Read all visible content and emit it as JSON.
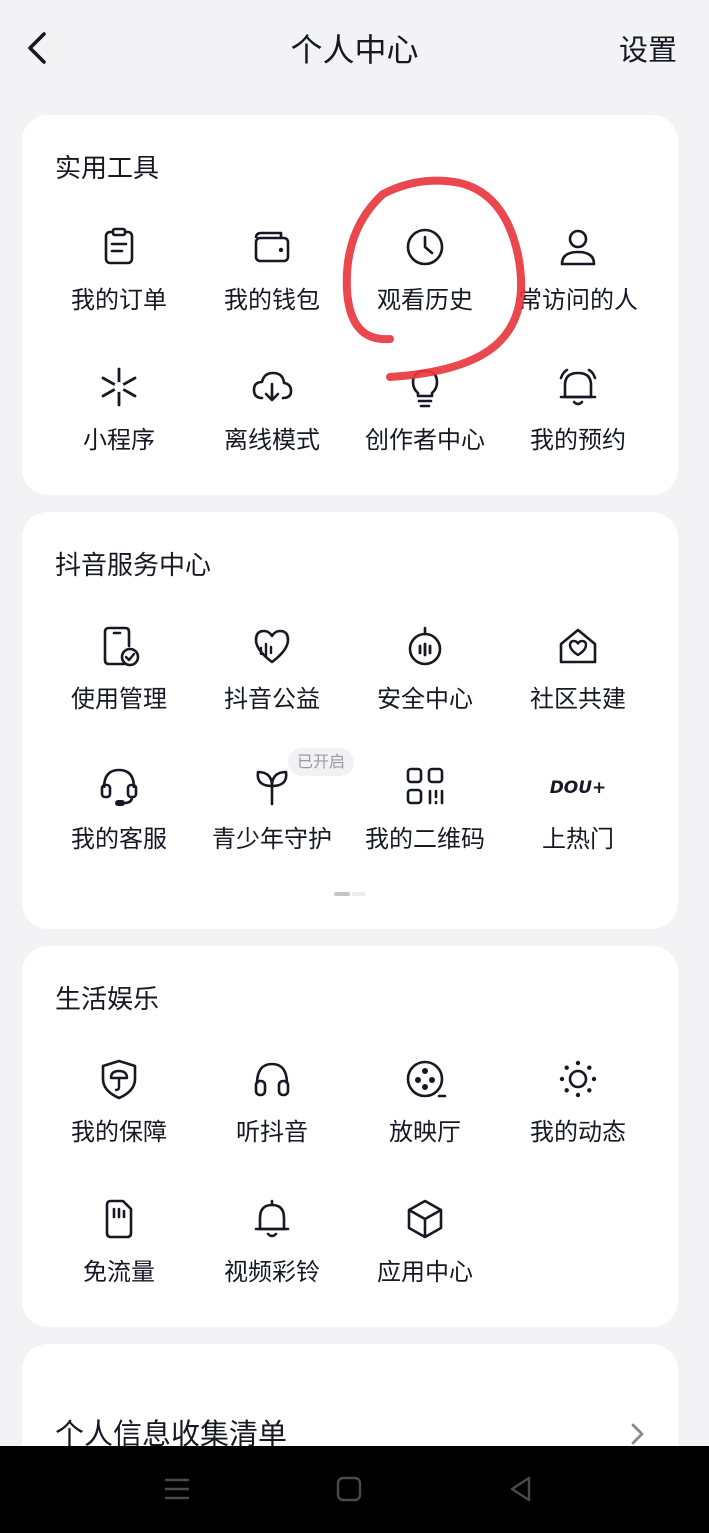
{
  "header": {
    "title": "个人中心",
    "settings_label": "设置"
  },
  "tools": {
    "title": "实用工具",
    "items": [
      {
        "label": "我的订单",
        "icon": "order-icon"
      },
      {
        "label": "我的钱包",
        "icon": "wallet-icon"
      },
      {
        "label": "观看历史",
        "icon": "clock-icon"
      },
      {
        "label": "常访问的人",
        "icon": "person-icon"
      },
      {
        "label": "小程序",
        "icon": "mini-program-icon"
      },
      {
        "label": "离线模式",
        "icon": "cloud-download-icon"
      },
      {
        "label": "创作者中心",
        "icon": "lightbulb-icon"
      },
      {
        "label": "我的预约",
        "icon": "bell-icon"
      }
    ]
  },
  "services": {
    "title": "抖音服务中心",
    "badge": "已开启",
    "items": [
      {
        "label": "使用管理",
        "icon": "phone-check-icon"
      },
      {
        "label": "抖音公益",
        "icon": "heart-icon"
      },
      {
        "label": "安全中心",
        "icon": "stopwatch-icon"
      },
      {
        "label": "社区共建",
        "icon": "home-heart-icon"
      },
      {
        "label": "我的客服",
        "icon": "headset-icon"
      },
      {
        "label": "青少年守护",
        "icon": "sprout-icon"
      },
      {
        "label": "我的二维码",
        "icon": "qr-code-icon"
      },
      {
        "label": "上热门",
        "icon": "dou-plus-icon",
        "icon_text": "DOU+"
      }
    ]
  },
  "life": {
    "title": "生活娱乐",
    "items": [
      {
        "label": "我的保障",
        "icon": "shield-icon"
      },
      {
        "label": "听抖音",
        "icon": "headphones-icon"
      },
      {
        "label": "放映厅",
        "icon": "film-reel-icon"
      },
      {
        "label": "我的动态",
        "icon": "sun-dots-icon"
      },
      {
        "label": "免流量",
        "icon": "sim-card-icon"
      },
      {
        "label": "视频彩铃",
        "icon": "ringtone-bell-icon"
      },
      {
        "label": "应用中心",
        "icon": "cube-icon"
      }
    ]
  },
  "privacy": {
    "label": "个人信息收集清单"
  },
  "colors": {
    "annotation": "#e8373f",
    "text": "#161823",
    "background": "#f3f3f5"
  }
}
